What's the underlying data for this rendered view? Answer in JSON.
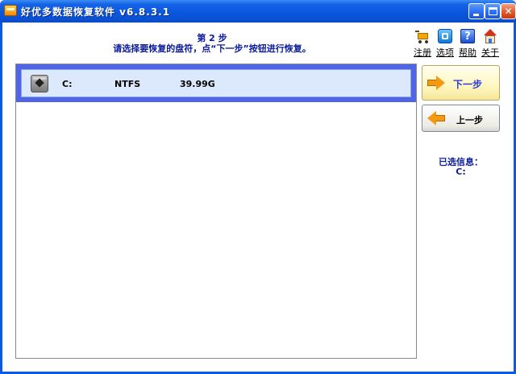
{
  "window": {
    "title": "好优多数据恢复软件  v6.8.3.1",
    "controls": {
      "minimize": "minimize",
      "maximize": "maximize",
      "close": "✕"
    }
  },
  "header": {
    "step_title": "第 2 步",
    "step_description": "请选择要恢复的盘符，点“下一步”按钮进行恢复。"
  },
  "toolbar": {
    "register": {
      "label": "注册",
      "icon": "cart-icon"
    },
    "options": {
      "label": "选项",
      "icon": "options-icon"
    },
    "help": {
      "label": "帮助",
      "icon": "help-icon",
      "glyph": "?"
    },
    "about": {
      "label": "关于",
      "icon": "home-icon"
    }
  },
  "drives": [
    {
      "name": "C:",
      "filesystem": "NTFS",
      "size": "39.99G",
      "selected": true
    }
  ],
  "buttons": {
    "next": "下一步",
    "prev": "上一步"
  },
  "selected_info": {
    "label": "已选信息：",
    "value": "C:"
  },
  "colors": {
    "title_bar": "#0a56dc",
    "selection_border": "#5064e6",
    "selection_fill": "#dce8fb",
    "accent_text": "#0a1a9a",
    "arrow": "#f59a10"
  }
}
